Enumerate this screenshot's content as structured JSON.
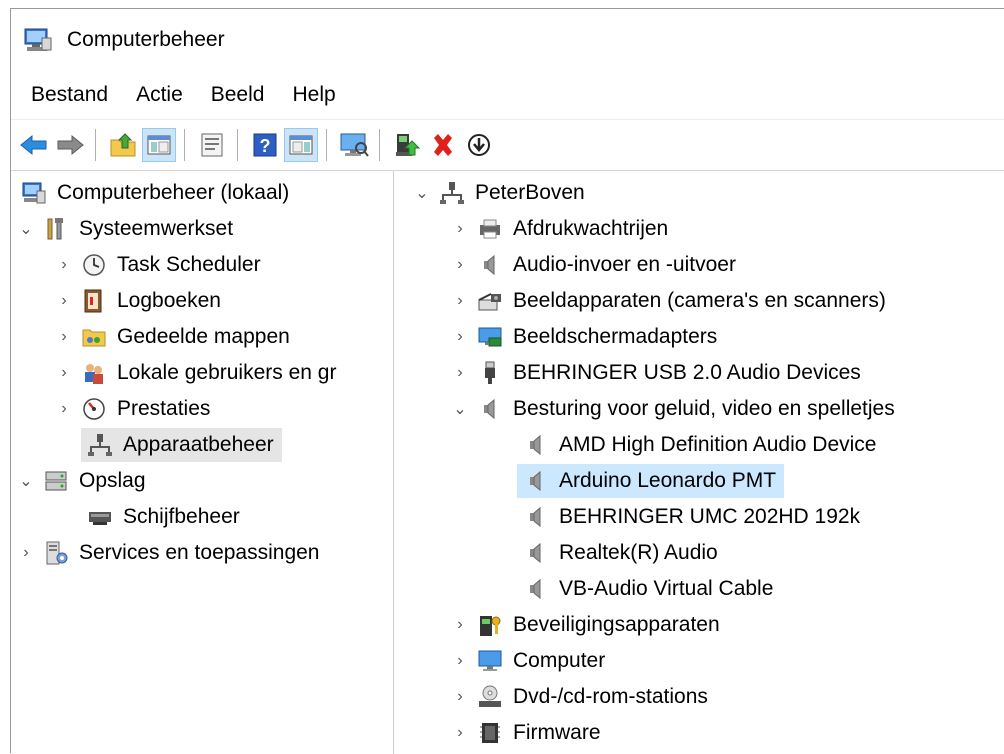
{
  "window": {
    "title": "Computerbeheer"
  },
  "menu": [
    "Bestand",
    "Actie",
    "Beeld",
    "Help"
  ],
  "toolbar": {
    "buttons": [
      "back-icon",
      "forward-icon",
      "up-folder-icon",
      "show-hide-console-tree-icon",
      "properties-icon",
      "help-icon",
      "show-action-pane-icon",
      "monitor-icon",
      "update-driver-icon",
      "uninstall-icon",
      "download-icon"
    ]
  },
  "left_tree": [
    {
      "label": "Computerbeheer (lokaal)",
      "icon": "computer-management-icon",
      "level": 0,
      "expander": "none"
    },
    {
      "label": "Systeemwerkset",
      "icon": "tools-icon",
      "level": 0,
      "expander": "expanded"
    },
    {
      "label": "Task Scheduler",
      "icon": "clock-icon",
      "level": 1,
      "expander": "collapsed"
    },
    {
      "label": "Logboeken",
      "icon": "event-log-icon",
      "level": 1,
      "expander": "collapsed"
    },
    {
      "label": "Gedeelde mappen",
      "icon": "shared-folder-icon",
      "level": 1,
      "expander": "collapsed"
    },
    {
      "label": "Lokale gebruikers en gr",
      "icon": "users-icon",
      "level": 1,
      "expander": "collapsed"
    },
    {
      "label": "Prestaties",
      "icon": "performance-icon",
      "level": 1,
      "expander": "collapsed"
    },
    {
      "label": "Apparaatbeheer",
      "icon": "device-manager-icon",
      "level": 1,
      "expander": "none",
      "selected": true
    },
    {
      "label": "Opslag",
      "icon": "storage-icon",
      "level": 0,
      "expander": "expanded"
    },
    {
      "label": "Schijfbeheer",
      "icon": "disk-icon",
      "level": 1,
      "expander": "none"
    },
    {
      "label": "Services en toepassingen",
      "icon": "services-icon",
      "level": 0,
      "expander": "collapsed"
    }
  ],
  "right_tree": [
    {
      "label": "PeterBoven",
      "icon": "network-computer-icon",
      "level": 0,
      "expander": "expanded"
    },
    {
      "label": "Afdrukwachtrijen",
      "icon": "printer-icon",
      "level": 1,
      "expander": "collapsed"
    },
    {
      "label": "Audio-invoer en -uitvoer",
      "icon": "speaker-icon",
      "level": 1,
      "expander": "collapsed"
    },
    {
      "label": "Beeldapparaten (camera's en scanners)",
      "icon": "camera-icon",
      "level": 1,
      "expander": "collapsed"
    },
    {
      "label": "Beeldschermadapters",
      "icon": "display-adapter-icon",
      "level": 1,
      "expander": "collapsed"
    },
    {
      "label": "BEHRINGER USB 2.0 Audio Devices",
      "icon": "usb-icon",
      "level": 1,
      "expander": "collapsed"
    },
    {
      "label": "Besturing voor geluid, video en spelletjes",
      "icon": "speaker-icon",
      "level": 1,
      "expander": "expanded"
    },
    {
      "label": "AMD High Definition Audio Device",
      "icon": "speaker-icon",
      "level": 2,
      "expander": "none"
    },
    {
      "label": "Arduino Leonardo PMT",
      "icon": "speaker-icon",
      "level": 2,
      "expander": "none",
      "selected": true
    },
    {
      "label": "BEHRINGER UMC 202HD 192k",
      "icon": "speaker-icon",
      "level": 2,
      "expander": "none"
    },
    {
      "label": "Realtek(R) Audio",
      "icon": "speaker-icon",
      "level": 2,
      "expander": "none"
    },
    {
      "label": "VB-Audio Virtual Cable",
      "icon": "speaker-icon",
      "level": 2,
      "expander": "none"
    },
    {
      "label": "Beveiligingsapparaten",
      "icon": "security-device-icon",
      "level": 1,
      "expander": "collapsed"
    },
    {
      "label": "Computer",
      "icon": "monitor-icon",
      "level": 1,
      "expander": "collapsed"
    },
    {
      "label": "Dvd-/cd-rom-stations",
      "icon": "dvd-icon",
      "level": 1,
      "expander": "collapsed"
    },
    {
      "label": "Firmware",
      "icon": "firmware-icon",
      "level": 1,
      "expander": "collapsed"
    }
  ],
  "colors": {
    "selection_blue": "#cce8ff",
    "selection_gray": "#e5e5e5",
    "accent": "#0a64c8",
    "delete_red": "#e0201a"
  }
}
